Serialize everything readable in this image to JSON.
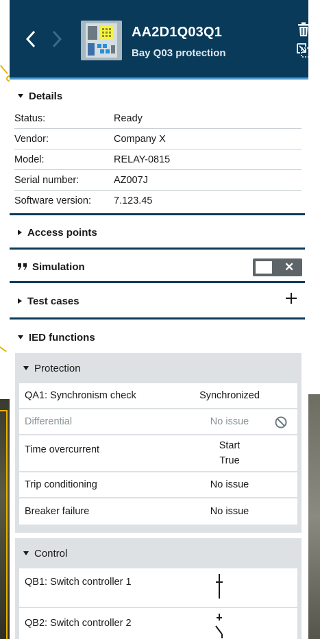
{
  "header": {
    "title": "AA2D1Q03Q1",
    "subtitle": "Bay Q03 protection"
  },
  "details": {
    "label": "Details",
    "rows": [
      {
        "key": "Status:",
        "value": "Ready"
      },
      {
        "key": "Vendor:",
        "value": "Company X"
      },
      {
        "key": "Model:",
        "value": "RELAY-0815"
      },
      {
        "key": "Serial number:",
        "value": "AZ007J"
      },
      {
        "key": "Software version:",
        "value": "7.123.45"
      }
    ]
  },
  "access_points": {
    "label": "Access points"
  },
  "simulation": {
    "label": "Simulation",
    "toggle_off_glyph": "✕",
    "enabled": false
  },
  "test_cases": {
    "label": "Test cases",
    "add_glyph": "+"
  },
  "ied_functions": {
    "label": "IED functions",
    "protection": {
      "label": "Protection",
      "rows": [
        {
          "name": "QA1: Synchronism check",
          "status": "Synchronized"
        },
        {
          "name": "Differential",
          "status": "No issue"
        },
        {
          "name": "Time overcurrent",
          "status_line1": "Start",
          "status_line2": "True"
        },
        {
          "name": "Trip conditioning",
          "status": "No issue"
        },
        {
          "name": "Breaker failure",
          "status": "No issue"
        }
      ]
    },
    "control": {
      "label": "Control",
      "rows": [
        {
          "name": "QB1: Switch controller 1",
          "state_icon": "switch-closed-icon"
        },
        {
          "name": "QB2: Switch controller 2",
          "state_icon": "switch-open-icon"
        }
      ]
    }
  },
  "colors": {
    "header_bg": "#093a5a",
    "accent": "#4a9ad0",
    "callout": "#e8b400"
  }
}
